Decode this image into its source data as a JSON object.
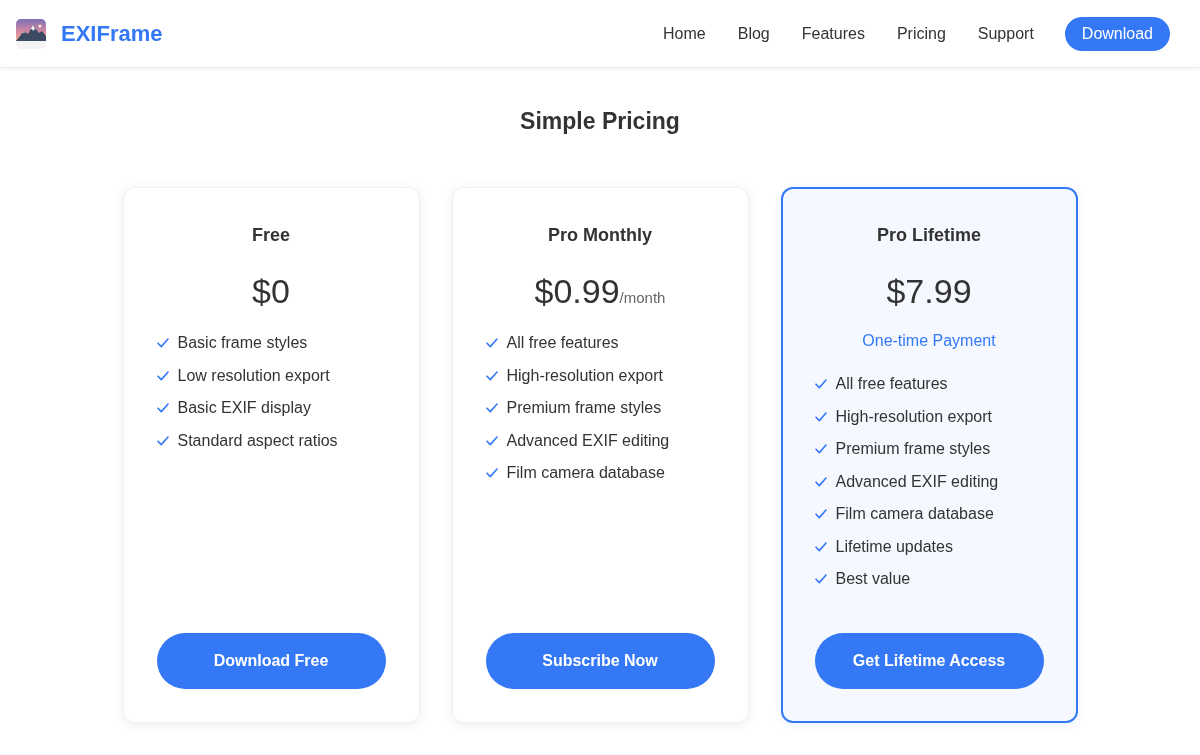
{
  "header": {
    "brand": "EXIFrame",
    "nav": [
      "Home",
      "Blog",
      "Features",
      "Pricing",
      "Support"
    ],
    "cta": "Download"
  },
  "title": "Simple Pricing",
  "plans": [
    {
      "name": "Free",
      "price": "$0",
      "features": [
        "Basic frame styles",
        "Low resolution export",
        "Basic EXIF display",
        "Standard aspect ratios"
      ],
      "button": "Download Free",
      "featured": false
    },
    {
      "name": "Pro Monthly",
      "price": "$0.99",
      "period": "/month",
      "features": [
        "All free features",
        "High-resolution export",
        "Premium frame styles",
        "Advanced EXIF editing",
        "Film camera database"
      ],
      "button": "Subscribe Now",
      "featured": false
    },
    {
      "name": "Pro Lifetime",
      "price": "$7.99",
      "note": "One-time Payment",
      "features": [
        "All free features",
        "High-resolution export",
        "Premium frame styles",
        "Advanced EXIF editing",
        "Film camera database",
        "Lifetime updates",
        "Best value"
      ],
      "button": "Get Lifetime Access",
      "featured": true
    }
  ]
}
